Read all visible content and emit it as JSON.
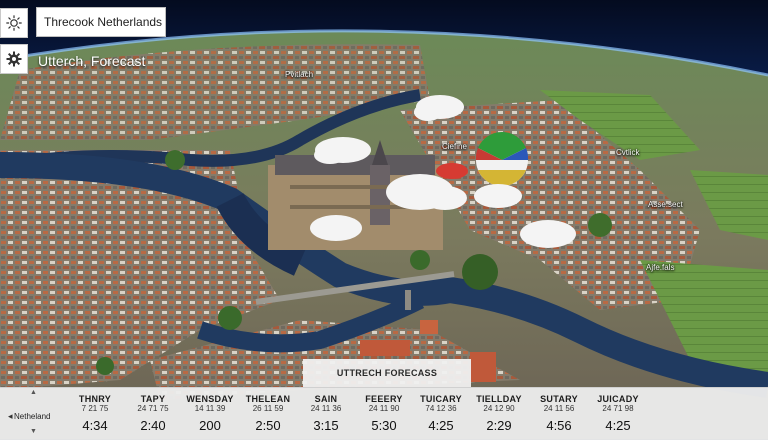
{
  "toolbar": {
    "sun_icon": "sun-icon",
    "gear_icon": "gear-icon",
    "search_value": "Threcook Netherlands",
    "forecast_title": "Utterch, Forecast"
  },
  "map_labels": {
    "top": "Pvitlach",
    "center": "Ciefine",
    "right_top": "Cvtlick",
    "right_mid": "Asse.sect",
    "right_low": "Ajfe.fals"
  },
  "forecast": {
    "header": "UTTRECH FORECASS",
    "location": {
      "name": "Netheland",
      "up_glyph": "▲",
      "left_glyph": "◂",
      "down_glyph": "▼"
    },
    "days": [
      {
        "name": "THNRY",
        "time": "7 21 75",
        "value": "4:34"
      },
      {
        "name": "TAPY",
        "time": "24 71 75",
        "value": "2:40"
      },
      {
        "name": "WENSDAY",
        "time": "14 11 39",
        "value": "200"
      },
      {
        "name": "THELEAN",
        "time": "26 11 59",
        "value": "2:50"
      },
      {
        "name": "SAIN",
        "time": "24 11 36",
        "value": "3:15"
      },
      {
        "name": "FEEERY",
        "time": "24 11 90",
        "value": "5:30"
      },
      {
        "name": "TUICARY",
        "time": "74 12 36",
        "value": "4:25"
      },
      {
        "name": "TIELLDAY",
        "time": "24 12 90",
        "value": "2:29"
      },
      {
        "name": "SUTARY",
        "time": "24 11 56",
        "value": "4:56"
      },
      {
        "name": "JUICADY",
        "time": "24 71 98",
        "value": "4:25"
      }
    ]
  },
  "colors": {
    "sky": "#0b1a3a",
    "river": "#1f3558",
    "grass": "#5f8a3c",
    "roofs": "#b0603e",
    "panel": "#ececec"
  }
}
